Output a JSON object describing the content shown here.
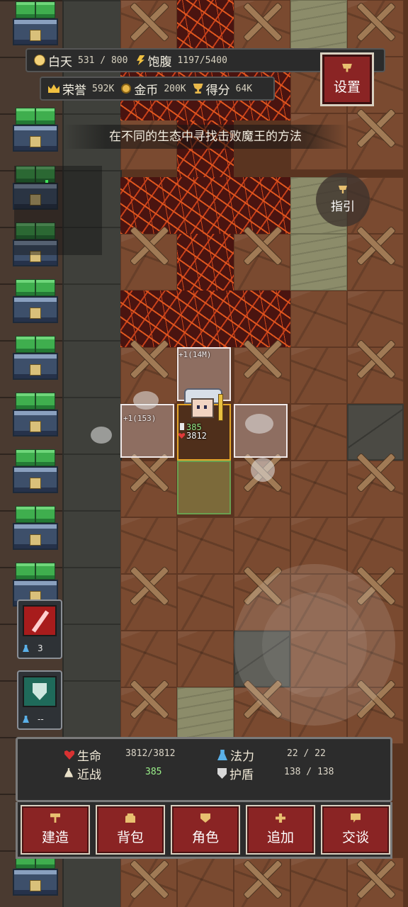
{
  "hud": {
    "day_label": "白天",
    "day_value": "531 / 800",
    "hunger_label": "饱腹",
    "hunger_value": "1197/5400",
    "honor_label": "荣誉",
    "honor_value": "592K",
    "gold_label": "金币",
    "gold_value": "200K",
    "score_label": "得分",
    "score_value": "64K",
    "settings_label": "设置"
  },
  "quest": {
    "text": "在不同的生态中寻找击败魔王的方法"
  },
  "guide": {
    "label": "指引"
  },
  "combat": {
    "top_tile_text": "+1(14M)",
    "left_tile_text": "+1(153)",
    "hero_attack": "385",
    "hero_hp": "3812"
  },
  "skills": [
    {
      "icon": "red-sword-icon",
      "count": "3"
    },
    {
      "icon": "green-shield-icon",
      "count": "--"
    }
  ],
  "stats": {
    "hp_label": "生命",
    "hp_value": "3812/3812",
    "mp_label": "法力",
    "mp_value": "22 / 22",
    "melee_label": "近战",
    "melee_value": "385",
    "shield_label": "护盾",
    "shield_value": "138 / 138"
  },
  "actions": {
    "build": "建造",
    "bag": "背包",
    "character": "角色",
    "add": "追加",
    "talk": "交谈"
  },
  "colors": {
    "accent_red": "#8a2424",
    "lava": "#c8401a",
    "panel": "#2c2c2c"
  }
}
